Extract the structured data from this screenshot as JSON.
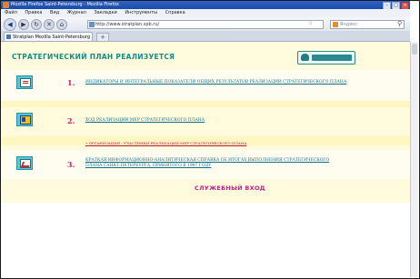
{
  "window": {
    "title": "Mozilla Firefox Saint-Petersburg - Mozilla Firefox"
  },
  "menubar": {
    "items": [
      "Файл",
      "Правка",
      "Вид",
      "Журнал",
      "Закладки",
      "Инструменты",
      "Справка"
    ]
  },
  "navbar": {
    "url": "http://www.stratplan.spb.ru/",
    "search_placeholder": "Яндекс"
  },
  "tabs": [
    {
      "label": "Stratplan Mozilla Saint-Petersburg"
    }
  ],
  "page": {
    "heading": "СТРАТЕГИЧЕСКИЙ ПЛАН РЕАЛИЗУЕТСЯ",
    "items": [
      {
        "number": "1.",
        "icon": "document-icon",
        "lines": [
          "ИНДИКАТОРЫ И ИНТЕГРАЛЬНЫЕ ПОКАЗАТЕЛИ ОБЩИХ РЕЗУЛЬТАТОВ РЕАЛИЗАЦИИ СТРАТЕГИЧЕСКОГО ПЛАНА"
        ]
      },
      {
        "number": "2.",
        "icon": "cube-icon",
        "lines": [
          "ХОД РЕАЛИЗАЦИИ МЕР СТРАТЕГИЧЕСКОГО ПЛАНА"
        ],
        "sub_link": "ОРГАНИЗАЦИЯ - УЧАСТНИКИ РЕАЛИЗАЦИИ МЕР СТРАТЕГИЧЕСКОГО ПЛАНА"
      },
      {
        "number": "3.",
        "icon": "chart-icon",
        "lines": [
          "КРАТКАЯ ИНФОРМАЦИОННО-АНАЛИТИЧЕСКАЯ СПРАВКА ОБ ИТОГАХ ВЫПОЛНЕНИЯ СТРАТЕГИЧЕСКОГО",
          "ПЛАНА САНКТ-ПЕТЕРБУРГА, ПРИНЯТОГО В 1997 ГОДУ"
        ]
      }
    ],
    "service_login": "СЛУЖЕБНЫЙ ВХОД"
  }
}
